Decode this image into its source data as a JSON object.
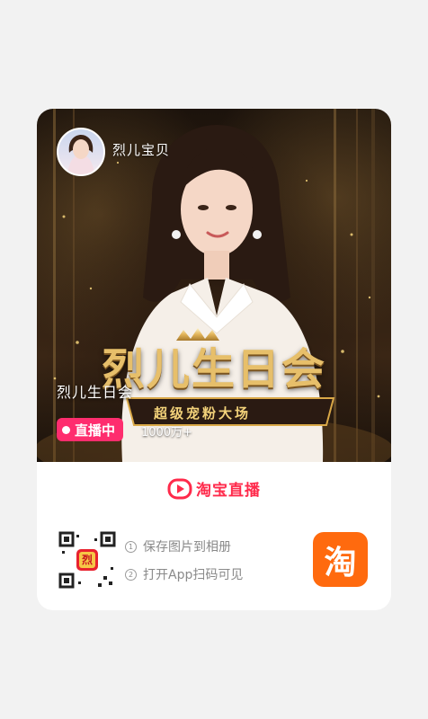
{
  "host": {
    "name": "烈儿宝贝"
  },
  "cover": {
    "title": "烈儿生日会",
    "poster_text": "烈儿生日会",
    "poster_subtext": "超级宠粉大场",
    "live_label": "直播中",
    "viewers": "1000万+"
  },
  "brand": {
    "name": "淘宝直播",
    "icon": "play-icon",
    "color": "#ff2a4b"
  },
  "steps": [
    {
      "num": "1",
      "text": "保存图片到相册"
    },
    {
      "num": "2",
      "text": "打开App扫码可见"
    }
  ],
  "app_icon": {
    "glyph": "淘",
    "color": "#ff6a0e"
  },
  "qr_logo_text": "烈"
}
